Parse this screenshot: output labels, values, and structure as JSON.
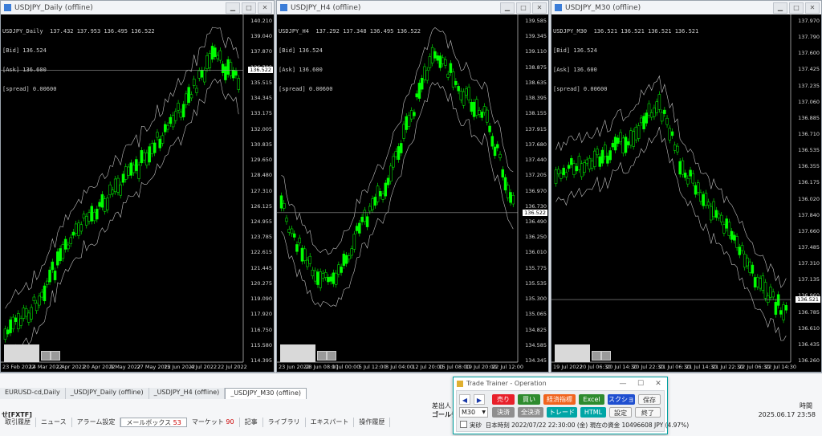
{
  "windows": [
    {
      "title": "USDJPY_Daily (offline)",
      "info_lines": [
        "USDJPY_Daily  137.432 137.953 136.495 136.522",
        "[Bid] 136.524",
        "[Ask] 136.600",
        "[spread] 0.00600"
      ],
      "y_ticks": [
        "140.210",
        "139.040",
        "137.870",
        "136.700",
        "135.515",
        "134.345",
        "133.175",
        "132.005",
        "130.835",
        "129.650",
        "128.480",
        "127.310",
        "126.125",
        "124.955",
        "123.785",
        "122.615",
        "121.445",
        "120.275",
        "119.090",
        "117.920",
        "116.750",
        "115.580",
        "114.395"
      ],
      "current_price": "136.522",
      "x_ticks": [
        "23 Feb 2022",
        "14 Mar 2022",
        "1 Apr 2022",
        "20 Apr 2022",
        "9 May 2022",
        "27 May 2022",
        "15 Jun 2022",
        "4 Jul 2022",
        "22 Jul 2022"
      ]
    },
    {
      "title": "USDJPY_H4 (offline)",
      "info_lines": [
        "USDJPY_H4  137.292 137.348 136.495 136.522",
        "[Bid] 136.524",
        "[Ask] 136.600",
        "[spread] 0.00600"
      ],
      "y_ticks": [
        "139.585",
        "139.345",
        "139.110",
        "138.875",
        "138.635",
        "138.395",
        "138.155",
        "137.915",
        "137.680",
        "137.440",
        "137.205",
        "136.970",
        "136.730",
        "136.490",
        "136.250",
        "136.010",
        "135.775",
        "135.535",
        "135.300",
        "135.065",
        "134.825",
        "134.585",
        "134.345"
      ],
      "current_price": "136.522",
      "x_ticks": [
        "23 Jun 2022",
        "28 Jun 08:00",
        "1 Jul 00:00",
        "5 Jul 12:00",
        "8 Jul 04:00",
        "12 Jul 20:00",
        "15 Jul 08:00",
        "19 Jul 20:00",
        "22 Jul 12:00"
      ]
    },
    {
      "title": "USDJPY_M30 (offline)",
      "info_lines": [
        "USDJPY_M30  136.521 136.521 136.521 136.521",
        "[Bid] 136.524",
        "[Ask] 136.600",
        "[spread] 0.00600"
      ],
      "y_ticks": [
        "137.970",
        "137.790",
        "137.600",
        "137.425",
        "137.235",
        "137.060",
        "136.885",
        "136.710",
        "136.535",
        "136.355",
        "136.175",
        "136.020",
        "137.840",
        "137.660",
        "137.485",
        "137.310",
        "137.135",
        "136.960",
        "136.785",
        "136.610",
        "136.435",
        "136.260"
      ],
      "current_price": "136.521",
      "x_ticks": [
        "19 Jul 2022",
        "20 Jul 06:30",
        "20 Jul 14:30",
        "20 Jul 22:30",
        "21 Jul 06:30",
        "21 Jul 14:30",
        "21 Jul 22:30",
        "22 Jul 06:30",
        "22 Jul 14:30"
      ]
    }
  ],
  "terminal": {
    "symbol_tabs": [
      "EURUSD-cd,Daily",
      "_USDJPY_Daily (offline)",
      "_USDJPY_H4 (offline)",
      "_USDJPY_M30 (offline)"
    ],
    "active_symbol_tab": 3,
    "left_label": "せ[FXTF]",
    "col_issuer": "差出人",
    "col_issuer_value": "ゴールデ",
    "col_time": "時間",
    "time_value": "2025.06.17 23:58",
    "bottom_tabs": [
      {
        "label": "取引履歴",
        "count": ""
      },
      {
        "label": "ニュース",
        "count": ""
      },
      {
        "label": "アラーム設定",
        "count": ""
      },
      {
        "label": "メールボックス",
        "count": "53"
      },
      {
        "label": "マーケット",
        "count": "90"
      },
      {
        "label": "記事",
        "count": ""
      },
      {
        "label": "ライブラリ",
        "count": ""
      },
      {
        "label": "エキスパート",
        "count": ""
      },
      {
        "label": "操作履歴",
        "count": ""
      }
    ]
  },
  "dialog": {
    "title": "Trade Trainer - Operation",
    "buttons": {
      "sell": "売り",
      "buy": "買い",
      "indicator": "経済指標",
      "excel": "Excel",
      "screenshot": "スクショ",
      "save": "保存",
      "settle": "決済",
      "settle_all": "全決済",
      "trade": "トレード",
      "html": "HTML",
      "settings": "設定",
      "exit": "終了"
    },
    "timeframe": "M30",
    "live_label": "実砂",
    "status_text": "日本時刻 2022/07/22 22:30:00 (金)  現在の資金 10496608 JPY (4.97%)"
  },
  "colors": {
    "chart_bg": "#000000",
    "candle": "#00ff00",
    "band": "#c0c0c0",
    "sell": "#e8202a",
    "buy": "#2e8b2e",
    "indicator": "#f0641e",
    "excel": "#2e8b2e",
    "screenshot": "#1f4fd0",
    "gray": "#8f8f8f",
    "teal": "#00a6a6"
  }
}
